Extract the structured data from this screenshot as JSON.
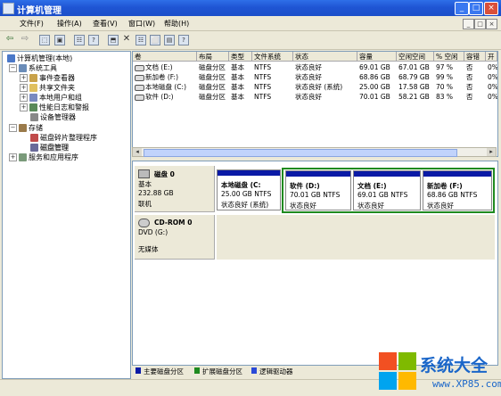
{
  "window": {
    "title": "计算机管理",
    "buttons": [
      "_",
      "□",
      "×"
    ]
  },
  "menu": {
    "items": [
      "文件(F)",
      "操作(A)",
      "查看(V)",
      "窗口(W)",
      "帮助(H)"
    ],
    "mdi_buttons": [
      "_",
      "□",
      "×"
    ]
  },
  "toolbar": {
    "icons": [
      "back-arrow-icon",
      "forward-arrow-icon",
      "up-folder-icon",
      "console-tree-icon",
      "properties-icon",
      "help-icon",
      "export-icon",
      "delete-icon",
      "properties-icon",
      "open-icon",
      "save-icon",
      "help-icon"
    ],
    "glyphs": [
      "⇦",
      "⇨",
      "⬚",
      "▣",
      "☷",
      "?",
      "⬒",
      "✕",
      "☷",
      "⬜",
      "▤",
      "?"
    ]
  },
  "tree": {
    "items": [
      {
        "label": "计算机管理(本地)",
        "indent": 0,
        "exp": "",
        "color": "#4a78c8"
      },
      {
        "label": "系统工具",
        "indent": 1,
        "exp": "−",
        "color": "#6a8cb8"
      },
      {
        "label": "事件查看器",
        "indent": 2,
        "exp": "+",
        "color": "#c9a24a"
      },
      {
        "label": "共享文件夹",
        "indent": 2,
        "exp": "+",
        "color": "#e0c060"
      },
      {
        "label": "本地用户和组",
        "indent": 2,
        "exp": "+",
        "color": "#7a8ac0"
      },
      {
        "label": "性能日志和警报",
        "indent": 2,
        "exp": "+",
        "color": "#5a8a5a"
      },
      {
        "label": "设备管理器",
        "indent": 2,
        "exp": "",
        "color": "#888888"
      },
      {
        "label": "存储",
        "indent": 1,
        "exp": "−",
        "color": "#9a7a4a"
      },
      {
        "label": "磁盘碎片整理程序",
        "indent": 2,
        "exp": "",
        "color": "#c04a4a"
      },
      {
        "label": "磁盘管理",
        "indent": 2,
        "exp": "",
        "color": "#6a6a9a",
        "selected": true
      },
      {
        "label": "服务和应用程序",
        "indent": 1,
        "exp": "+",
        "color": "#7a9a7a"
      }
    ]
  },
  "volume_table": {
    "columns": [
      "卷",
      "布局",
      "类型",
      "文件系统",
      "状态",
      "容量",
      "空闲空间",
      "% 空闲",
      "容错",
      "开"
    ],
    "rows": [
      [
        "文档 (E:)",
        "磁盘分区",
        "基本",
        "NTFS",
        "状态良好",
        "69.01 GB",
        "67.01 GB",
        "97 %",
        "否",
        "0%"
      ],
      [
        "新加卷 (F:)",
        "磁盘分区",
        "基本",
        "NTFS",
        "状态良好",
        "68.86 GB",
        "68.79 GB",
        "99 %",
        "否",
        "0%"
      ],
      [
        "本地磁盘 (C:)",
        "磁盘分区",
        "基本",
        "NTFS",
        "状态良好 (系统)",
        "25.00 GB",
        "17.58 GB",
        "70 %",
        "否",
        "0%"
      ],
      [
        "软件 (D:)",
        "磁盘分区",
        "基本",
        "NTFS",
        "状态良好",
        "70.01 GB",
        "58.21 GB",
        "83 %",
        "否",
        "0%"
      ]
    ]
  },
  "disks": [
    {
      "name": "磁盘 0",
      "type": "基本",
      "size": "232.88 GB",
      "status": "联机",
      "partitions": [
        {
          "name": "本地磁盘 (C:",
          "size_fs": "25.00 GB NTFS",
          "state": "状态良好 (系统)"
        },
        {
          "name": "软件 (D:)",
          "size_fs": "70.01 GB NTFS",
          "state": "状态良好"
        },
        {
          "name": "文档 (E:)",
          "size_fs": "69.01 GB NTFS",
          "state": "状态良好"
        },
        {
          "name": "新加卷 (F:)",
          "size_fs": "68.86 GB NTFS",
          "state": "状态良好"
        }
      ]
    },
    {
      "name": "CD-ROM 0",
      "type": "DVD (G:)",
      "status": "无媒体"
    }
  ],
  "legend": [
    {
      "label": "主要磁盘分区",
      "color": "#0a1aa6"
    },
    {
      "label": "扩展磁盘分区",
      "color": "#1f8a1f"
    },
    {
      "label": "逻辑驱动器",
      "color": "#2a4ad8"
    }
  ],
  "watermark": {
    "brand": "系统大全",
    "url": "www.XP85.com",
    "tile_colors": [
      "#f25022",
      "#7fba00",
      "#00a4ef",
      "#ffb900"
    ]
  }
}
